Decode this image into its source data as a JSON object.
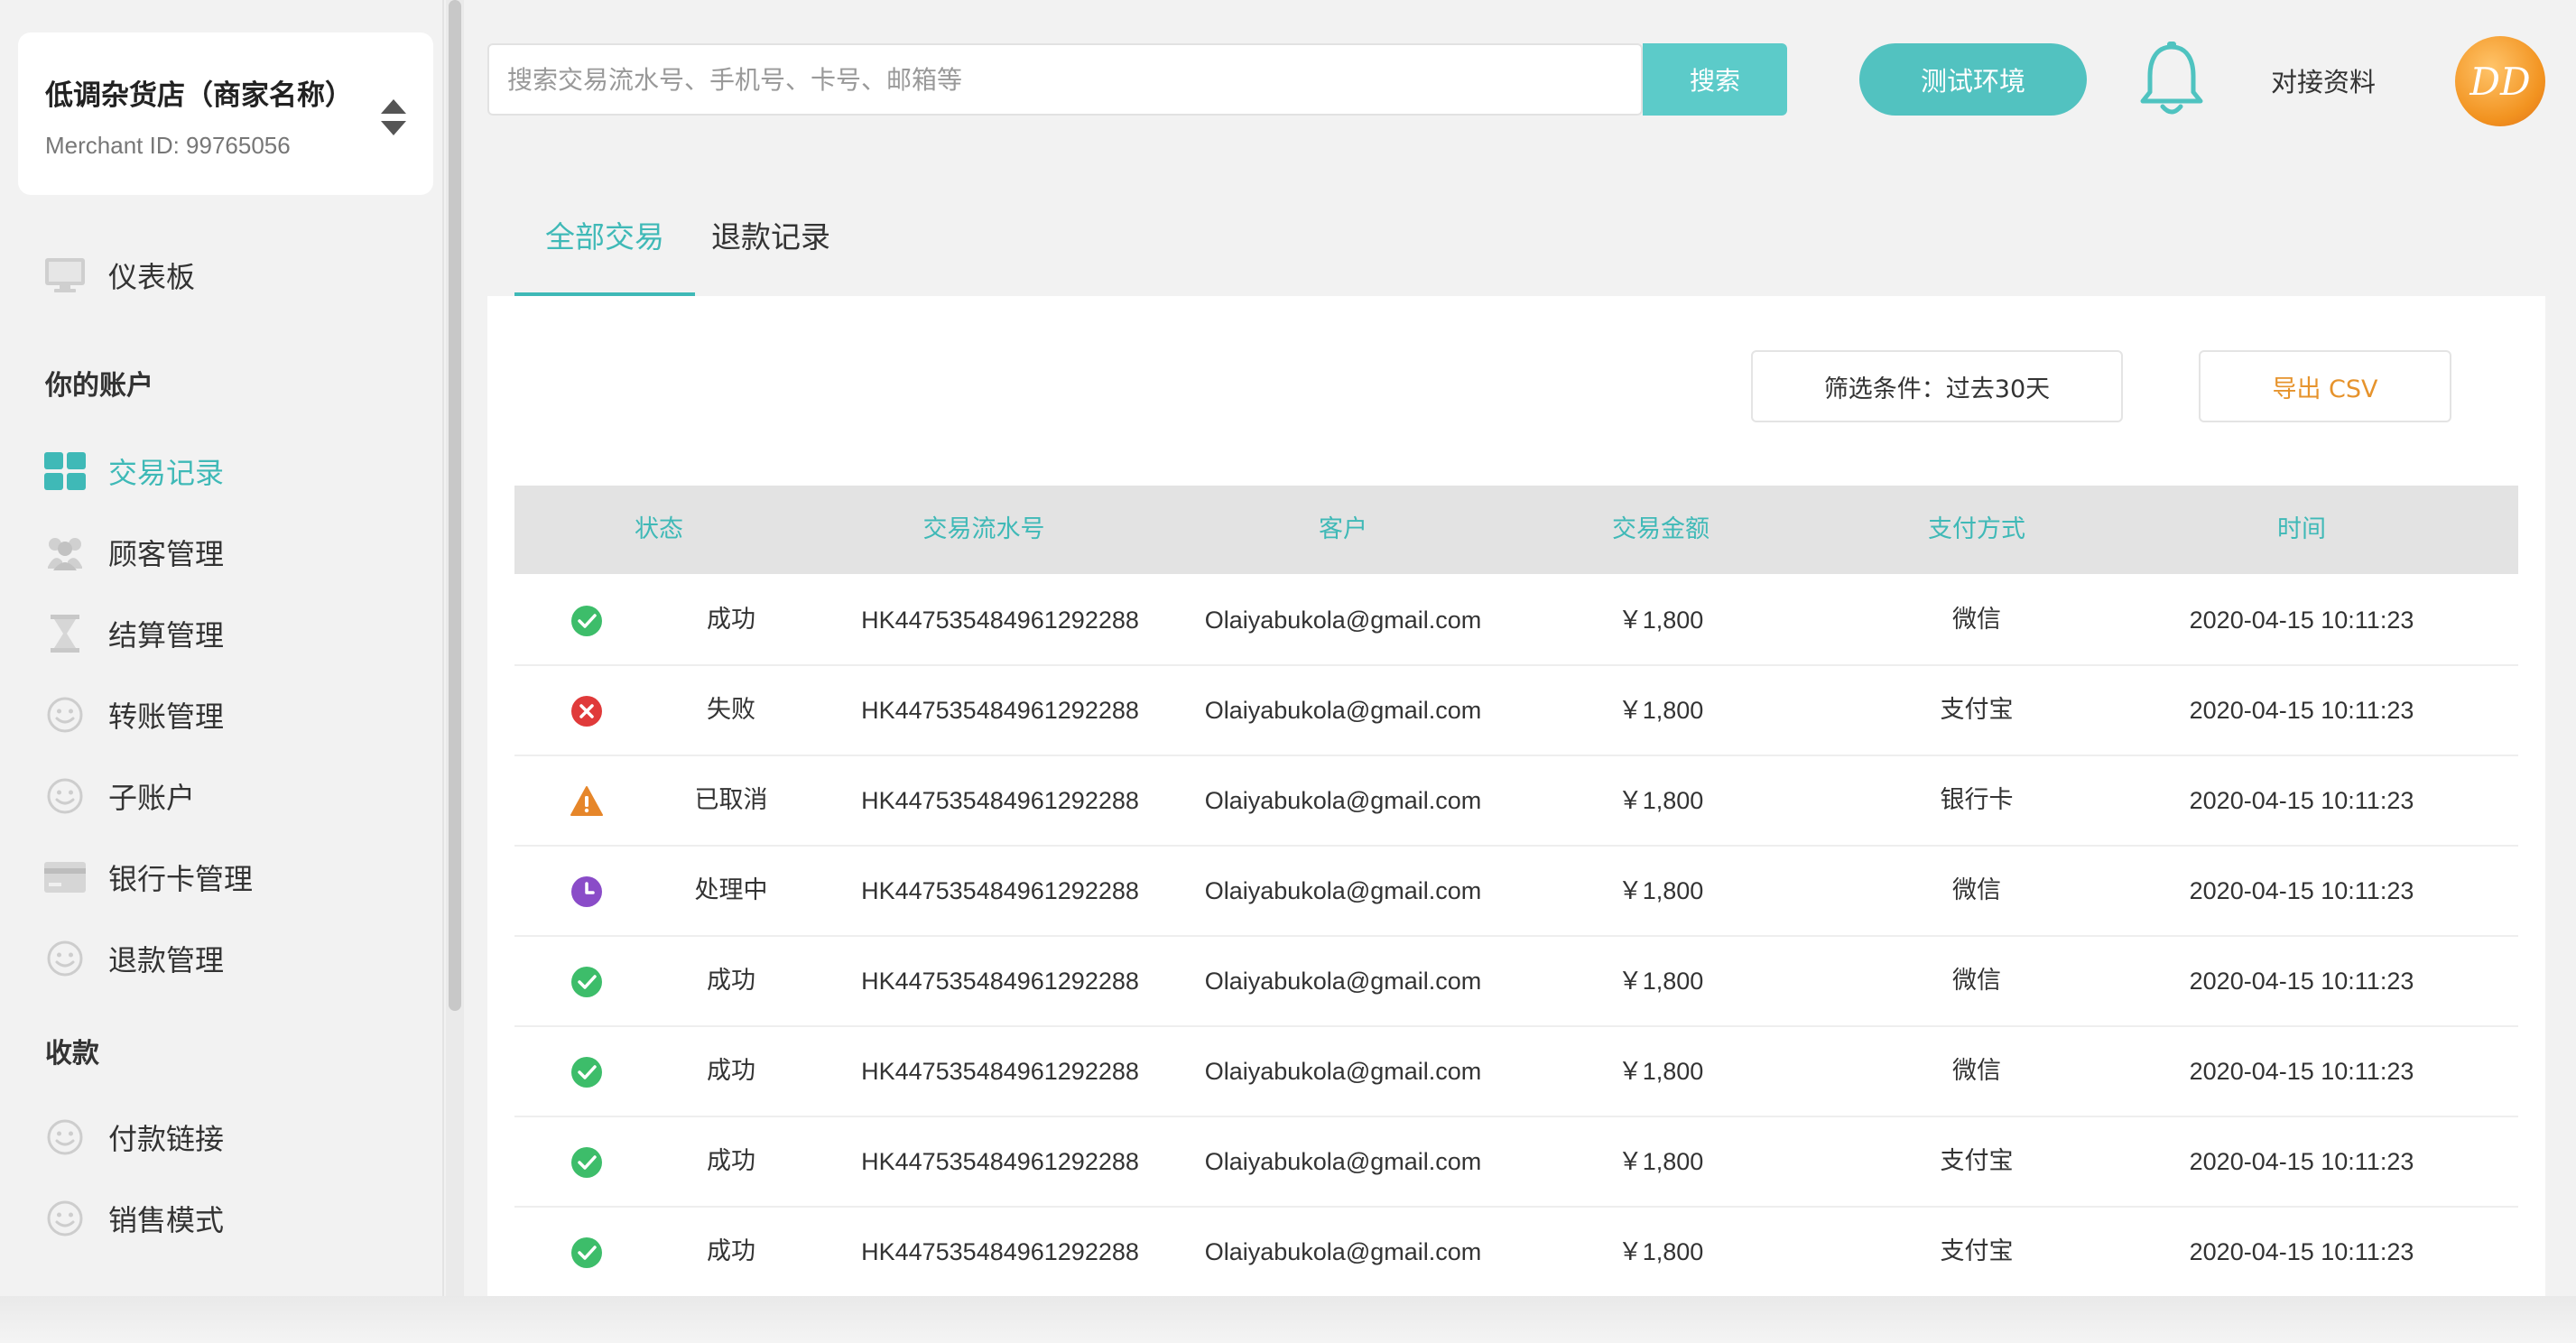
{
  "merchant": {
    "name": "低调杂货店（商家名称）",
    "id": "Merchant ID: 99765056"
  },
  "sidebar": {
    "dashboard": "仪表板",
    "section_account": "你的账户",
    "account_items": [
      {
        "label": "交易记录",
        "icon": "grid-icon",
        "active": true
      },
      {
        "label": "顾客管理",
        "icon": "users-icon"
      },
      {
        "label": "结算管理",
        "icon": "hourglass-icon"
      },
      {
        "label": "转账管理",
        "icon": "smiley-icon"
      },
      {
        "label": "子账户",
        "icon": "smiley-icon"
      },
      {
        "label": "银行卡管理",
        "icon": "card-icon"
      },
      {
        "label": "退款管理",
        "icon": "smiley-icon"
      }
    ],
    "section_payments": "收款",
    "payment_items": [
      {
        "label": "付款链接",
        "icon": "smiley-icon"
      },
      {
        "label": "销售模式",
        "icon": "smiley-icon"
      }
    ]
  },
  "header": {
    "search_placeholder": "搜索交易流水号、手机号、卡号、邮箱等",
    "search_value": "",
    "search_button": "搜索",
    "env_button": "测试环境",
    "docs_link": "对接资料",
    "avatar_text": "DD"
  },
  "tabs": [
    {
      "label": "全部交易",
      "active": true
    },
    {
      "label": "退款记录",
      "active": false
    }
  ],
  "toolbar": {
    "filter_label": "筛选条件：过去30天",
    "export_label": "导出 CSV"
  },
  "colors": {
    "accent": "#3fb9b7",
    "success": "#3dbd6a",
    "failed": "#e03a3a",
    "cancelled": "#e6862a",
    "processing": "#8a4cc8",
    "export": "#e6932c"
  },
  "table": {
    "columns": [
      "状态",
      "交易流水号",
      "客户",
      "交易金额",
      "支付方式",
      "时间"
    ],
    "rows": [
      {
        "status": "成功",
        "status_type": "success",
        "txn": "HK447535484961292288",
        "customer": "Olaiyabukola@gmail.com",
        "amount": "￥1,800",
        "method": "微信",
        "time": "2020-04-15 10:11:23"
      },
      {
        "status": "失败",
        "status_type": "failed",
        "txn": "HK447535484961292288",
        "customer": "Olaiyabukola@gmail.com",
        "amount": "￥1,800",
        "method": "支付宝",
        "time": "2020-04-15 10:11:23"
      },
      {
        "status": "已取消",
        "status_type": "cancelled",
        "txn": "HK447535484961292288",
        "customer": "Olaiyabukola@gmail.com",
        "amount": "￥1,800",
        "method": "银行卡",
        "time": "2020-04-15 10:11:23"
      },
      {
        "status": "处理中",
        "status_type": "processing",
        "txn": "HK447535484961292288",
        "customer": "Olaiyabukola@gmail.com",
        "amount": "￥1,800",
        "method": "微信",
        "time": "2020-04-15 10:11:23"
      },
      {
        "status": "成功",
        "status_type": "success",
        "txn": "HK447535484961292288",
        "customer": "Olaiyabukola@gmail.com",
        "amount": "￥1,800",
        "method": "微信",
        "time": "2020-04-15 10:11:23"
      },
      {
        "status": "成功",
        "status_type": "success",
        "txn": "HK447535484961292288",
        "customer": "Olaiyabukola@gmail.com",
        "amount": "￥1,800",
        "method": "微信",
        "time": "2020-04-15 10:11:23"
      },
      {
        "status": "成功",
        "status_type": "success",
        "txn": "HK447535484961292288",
        "customer": "Olaiyabukola@gmail.com",
        "amount": "￥1,800",
        "method": "支付宝",
        "time": "2020-04-15 10:11:23"
      },
      {
        "status": "成功",
        "status_type": "success",
        "txn": "HK447535484961292288",
        "customer": "Olaiyabukola@gmail.com",
        "amount": "￥1,800",
        "method": "支付宝",
        "time": "2020-04-15 10:11:23"
      }
    ]
  }
}
